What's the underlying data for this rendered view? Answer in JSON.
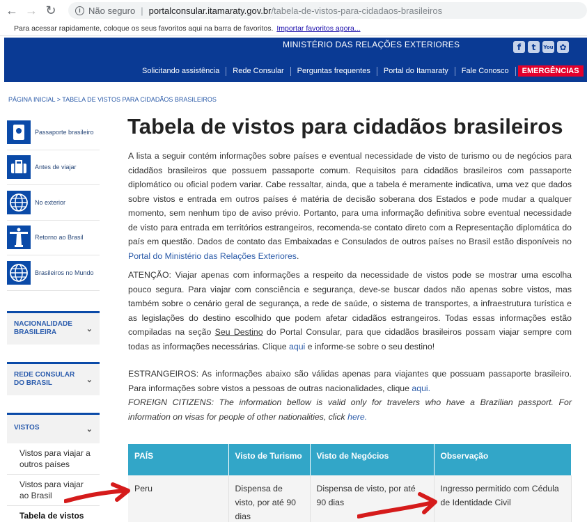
{
  "browser": {
    "back_icon": "back-arrow-icon",
    "forward_icon": "forward-arrow-icon",
    "reload_icon": "reload-icon",
    "security_label": "Não seguro",
    "url_host": "portalconsular.itamaraty.gov.br",
    "url_path": "/tabela-de-vistos-para-cidadaos-brasileiros",
    "bookmarks_text": "Para acessar rapidamente, coloque os seus favoritos aqui na barra de favoritos.",
    "bookmarks_link": "Importar favoritos agora..."
  },
  "header": {
    "ministry": "MINISTÉRIO DAS RELAÇÕES EXTERIORES",
    "socials": [
      "facebook-icon",
      "twitter-icon",
      "youtube-icon",
      "flickr-icon"
    ],
    "socials_text": {
      "facebook": "f",
      "twitter": "t",
      "youtube": "You",
      "flickr": "✿"
    },
    "nav": [
      "Solicitando assistência",
      "Rede Consular",
      "Perguntas frequentes",
      "Portal do Itamaraty",
      "Fale Conosco"
    ],
    "emergency": "EMERGÊNCIAS",
    "colors": {
      "primary": "#0a3a94",
      "emergency": "#e4002b",
      "table_header": "#32a6c8"
    }
  },
  "breadcrumb": "PÁGINA INICIAL > TABELA DE VISTOS PARA CIDADÃOS BRASILEIROS",
  "sidebar": {
    "icons": [
      {
        "label": "Passaporte brasileiro",
        "icon": "passport-icon"
      },
      {
        "label": "Antes de viajar",
        "icon": "suitcase-icon"
      },
      {
        "label": "No exterior",
        "icon": "globe-icon"
      },
      {
        "label": "Retorno ao Brasil",
        "icon": "christ-statue-icon"
      },
      {
        "label": "Brasileiros no Mundo",
        "icon": "globe-icon"
      }
    ],
    "accordions": [
      "NACIONALIDADE BRASILEIRA",
      "REDE CONSULAR DO BRASIL",
      "VISTOS"
    ],
    "vistos_items": [
      "Vistos para viajar a outros países",
      "Vistos para viajar ao Brasil",
      "Tabela de vistos"
    ]
  },
  "main": {
    "title": "Tabela de vistos para cidadãos brasileiros",
    "p1": "A lista a seguir contém informações sobre países e eventual necessidade de visto de turismo ou de negócios para cidadãos brasileiros que possuem passaporte comum. Requisitos para cidadãos brasileiros com passaporte diplomático ou oficial podem variar. Cabe ressaltar, ainda, que a tabela é meramente indicativa, uma vez que dados sobre vistos e entrada em outros países é matéria de decisão soberana dos Estados e pode mudar a qualquer momento, sem nenhum tipo de aviso prévio. Portanto, para uma informação definitiva sobre eventual necessidade de visto para entrada em territórios estrangeiros, recomenda-se contato direto com a Representação diplomática do país em questão. Dados de contato das Embaixadas e Consulados de outros países no Brasil estão disponíveis no ",
    "p1_link": "Portal do Ministério das Relações Exteriores",
    "p1_end": ".",
    "p2_start": "ATENÇÃO: Viajar apenas com informações a respeito da necessidade de vistos pode se mostrar uma escolha pouco segura. Para viajar com consciência e segurança, deve-se buscar dados não apenas sobre vistos, mas também sobre o cenário geral de segurança, a rede de saúde, o sistema de transportes, a infraestrutura turística e as legislações do destino escolhido que podem afetar cidadãos estrangeiros. Todas essas informações estão compiladas na seção ",
    "p2_destino": "Seu Destino",
    "p2_mid": " do Portal Consular, para que cidadãos brasileiros possam viajar sempre com todas as informações necessárias. Clique ",
    "p2_link": "aqui",
    "p2_end": " e informe-se sobre o seu destino!",
    "p3_start": "ESTRANGEIROS: As informações abaixo são válidas apenas para viajantes que possuam passaporte brasileiro. Para informações sobre vistos a pessoas de outras nacionalidades, clique ",
    "p3_link": "aqui.",
    "p4_start": "FOREIGN CITIZENS: The information bellow is valid only for travelers who have a Brazilian passport. For information on visas for people of other nationalities, click ",
    "p4_link": "here."
  },
  "table": {
    "headers": [
      "PAÍS",
      "Visto de Turismo",
      "Visto de Negócios",
      "Observação"
    ],
    "rows": [
      [
        "Peru",
        "Dispensa de visto, por até 90 dias",
        "Dispensa de visto, por até 90 dias",
        "Ingresso permitido com Cédula de Identidade Civil"
      ]
    ]
  }
}
